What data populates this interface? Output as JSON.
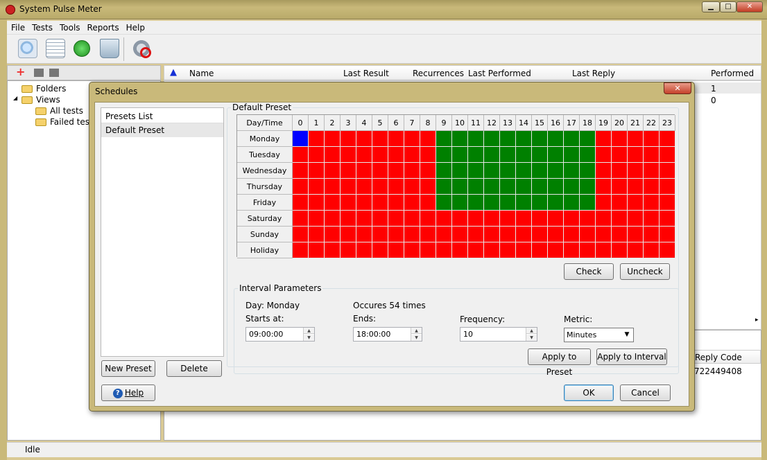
{
  "window": {
    "title": "System Pulse Meter",
    "controls": {
      "minimize": "▁",
      "maximize": "□",
      "close": "✕"
    }
  },
  "menu": [
    "File",
    "Tests",
    "Tools",
    "Reports",
    "Help"
  ],
  "toolbar": {
    "icons": [
      "search-doc-icon",
      "report-icon",
      "run-icon",
      "recycle-bin-icon",
      "settings-disabled-icon"
    ]
  },
  "tree": {
    "items": [
      {
        "label": "Folders"
      },
      {
        "label": "Views"
      },
      {
        "label": "All tests"
      },
      {
        "label": "Failed tests"
      }
    ]
  },
  "list": {
    "columns": [
      "Name",
      "Last Result",
      "Recurrences",
      "Last Performed",
      "Last Reply",
      "Performed"
    ],
    "performed_values": [
      "1",
      "0"
    ]
  },
  "bottom_panel": {
    "column": "Reply Code",
    "value": "722449408"
  },
  "status": {
    "text": "Idle"
  },
  "dialog": {
    "title": "Schedules",
    "close_label": "✕",
    "presets_header": "Presets List",
    "presets": [
      "Default Preset"
    ],
    "new_preset_label": "New Preset",
    "delete_label": "Delete",
    "help_label": "Help",
    "ok_label": "OK",
    "cancel_label": "Cancel",
    "preset_group_label": "Default Preset",
    "grid": {
      "corner_label": "Day/Time",
      "hours": [
        "0",
        "1",
        "2",
        "3",
        "4",
        "5",
        "6",
        "7",
        "8",
        "9",
        "10",
        "11",
        "12",
        "13",
        "14",
        "15",
        "16",
        "17",
        "18",
        "19",
        "20",
        "21",
        "22",
        "23"
      ],
      "days": [
        "Monday",
        "Tuesday",
        "Wednesday",
        "Thursday",
        "Friday",
        "Saturday",
        "Sunday",
        "Holiday"
      ],
      "checked_hours": {
        "Monday": [
          9,
          10,
          11,
          12,
          13,
          14,
          15,
          16,
          17,
          18
        ],
        "Tuesday": [
          9,
          10,
          11,
          12,
          13,
          14,
          15,
          16,
          17,
          18
        ],
        "Wednesday": [
          9,
          10,
          11,
          12,
          13,
          14,
          15,
          16,
          17,
          18
        ],
        "Thursday": [
          9,
          10,
          11,
          12,
          13,
          14,
          15,
          16,
          17,
          18
        ],
        "Friday": [
          9,
          10,
          11,
          12,
          13,
          14,
          15,
          16,
          17,
          18
        ],
        "Saturday": [],
        "Sunday": [],
        "Holiday": []
      },
      "selected": {
        "day": "Monday",
        "hour": 0
      },
      "colors": {
        "checked": "#008000",
        "unchecked": "#ff0000",
        "selected": "#0000ff"
      }
    },
    "check_label": "Check",
    "uncheck_label": "Uncheck",
    "interval": {
      "group_label": "Interval Parameters",
      "day_text": "Day: Monday",
      "occurs_text": "Occures 54 times",
      "starts_label": "Starts at:",
      "starts_value": "09:00:00",
      "ends_label": "Ends:",
      "ends_value": "18:00:00",
      "frequency_label": "Frequency:",
      "frequency_value": "10",
      "metric_label": "Metric:",
      "metric_value": "Minutes",
      "apply_preset_label": "Apply to Preset",
      "apply_interval_label": "Apply to Interval"
    }
  }
}
